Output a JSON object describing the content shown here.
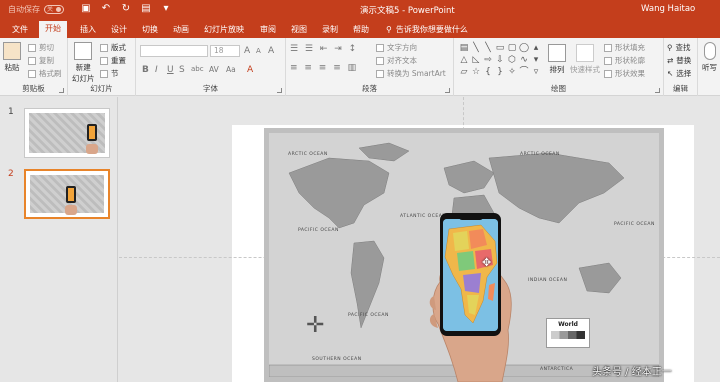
{
  "titlebar": {
    "autosave_label": "自动保存",
    "autosave_state": "关",
    "document_title": "演示文稿5 - PowerPoint",
    "user": "Wang Haitao"
  },
  "tabs": [
    {
      "label": "文件"
    },
    {
      "label": "开始",
      "active": true
    },
    {
      "label": "插入"
    },
    {
      "label": "设计"
    },
    {
      "label": "切换"
    },
    {
      "label": "动画"
    },
    {
      "label": "幻灯片放映"
    },
    {
      "label": "审阅"
    },
    {
      "label": "视图"
    },
    {
      "label": "录制"
    },
    {
      "label": "帮助"
    }
  ],
  "tell_me": "告诉我你想要做什么",
  "ribbon": {
    "clipboard": {
      "paste": "粘贴",
      "cut": "剪切",
      "copy": "复制",
      "format_painter": "格式刷",
      "label": "剪贴板"
    },
    "slides": {
      "new_slide": "新建",
      "new_slide_2": "幻灯片",
      "layout": "版式",
      "reset": "重置",
      "section": "节",
      "label": "幻灯片"
    },
    "font": {
      "size": "18",
      "bold": "B",
      "italic": "I",
      "underline": "U",
      "strike": "S",
      "shadow": "abc",
      "spacing": "AV",
      "case": "Aa",
      "clear": "A",
      "color": "A",
      "grow": "A",
      "shrink": "A",
      "label": "字体"
    },
    "paragraph": {
      "text_direction": "文字方向",
      "align_text": "对齐文本",
      "smartart": "转换为 SmartArt",
      "label": "段落"
    },
    "drawing": {
      "arrange": "排列",
      "quick_styles": "快速样式",
      "shape_fill": "形状填充",
      "shape_outline": "形状轮廓",
      "shape_effects": "形状效果",
      "label": "绘图"
    },
    "editing": {
      "find": "查找",
      "replace": "替换",
      "select": "选择",
      "label": "编辑"
    },
    "voice": {
      "dictate": "听写"
    }
  },
  "slides_pane": [
    {
      "number": "1",
      "selected": false
    },
    {
      "number": "2",
      "selected": true
    }
  ],
  "map": {
    "labels": [
      "ARCTIC OCEAN",
      "ARCTIC OCEAN",
      "PACIFIC OCEAN",
      "ATLANTIC OCEAN",
      "PACIFIC OCEAN",
      "PACIFIC OCEAN",
      "INDIAN OCEAN",
      "SOUTHERN OCEAN",
      "ANTARCTICA"
    ],
    "legend_title": "World"
  },
  "watermark": "头条号 / 经本正一",
  "colors": {
    "accent": "#c43e1c",
    "ribbon": "#f3f3f3",
    "selection": "#e8842a"
  }
}
